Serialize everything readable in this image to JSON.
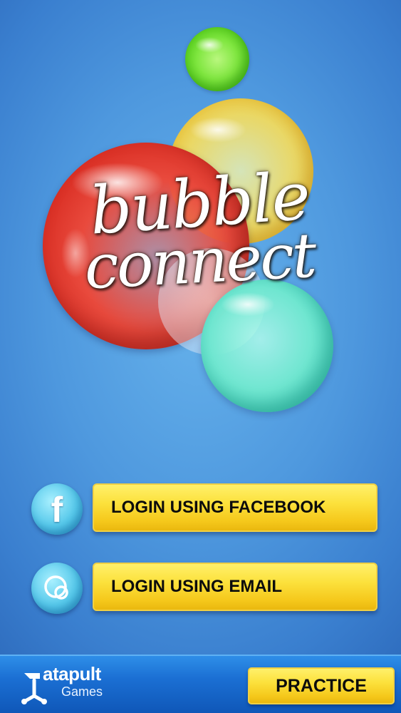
{
  "logo": {
    "line1": "bubble",
    "line2": "connect"
  },
  "login": {
    "facebook_label": "LOGIN USING FACEBOOK",
    "facebook_glyph": "f",
    "email_label": "LOGIN USING EMAIL"
  },
  "footer": {
    "brand_name": "atapult",
    "brand_sub": "Games",
    "practice_label": "PRACTICE"
  },
  "icons": {
    "facebook": "facebook-icon",
    "email": "email-icon",
    "brand": "catapult-logo-icon"
  },
  "colors": {
    "background": "#4e98de",
    "button_yellow": "#fce13c",
    "bottom_bar": "#1b6fd3",
    "bubble_red": "#e94a3d",
    "bubble_yellow": "#fade58",
    "bubble_green": "#7fe63f",
    "bubble_cyan": "#6fe6d0"
  }
}
